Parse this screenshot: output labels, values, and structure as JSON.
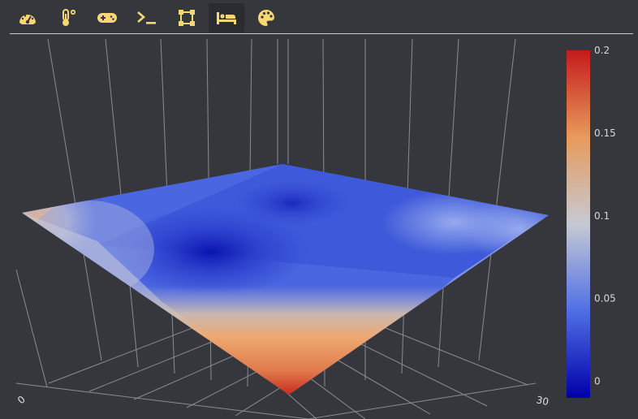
{
  "toolbar": {
    "items": [
      {
        "icon": "gauge-icon",
        "active": false
      },
      {
        "icon": "thermometer-icon",
        "active": false
      },
      {
        "icon": "gamepad-icon",
        "active": false
      },
      {
        "icon": "terminal-icon",
        "active": false
      },
      {
        "icon": "vector-square-icon",
        "active": false
      },
      {
        "icon": "bed-icon",
        "active": true
      },
      {
        "icon": "palette-icon",
        "active": false
      }
    ],
    "accent_color": "#f7d774"
  },
  "chart_data": {
    "type": "surface",
    "colorscale": [
      "#0000a8",
      "#4f6fe6",
      "#c6c9d3",
      "#e89a5c",
      "#c41a1a"
    ],
    "colorbar": {
      "ticks": [
        "0.2",
        "0.15",
        "0.1",
        "0.05",
        "0"
      ],
      "range": [
        -0.01,
        0.2
      ]
    },
    "axis_ticks": {
      "left": "0",
      "right": "30"
    },
    "corner_values": {
      "back": 0.06,
      "right": 0.08,
      "left": 0.12,
      "front": 0.2,
      "center": 0.0
    }
  }
}
